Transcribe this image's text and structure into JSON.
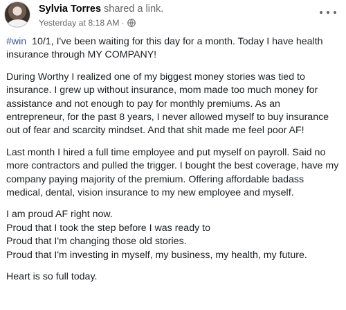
{
  "post": {
    "author": "Sylvia Torres",
    "action": "shared a link.",
    "timestamp": "Yesterday at 8:18 AM",
    "separator": "·",
    "privacy_icon": "globe-icon",
    "more_icon": "more-options-icon",
    "hashtag": "#win",
    "first_line": "10/1, I've been waiting for this day for a month. Today I have health insurance through MY COMPANY!",
    "paragraphs": [
      "During Worthy I realized one of my biggest money stories was tied to insurance. I grew up without insurance, mom made too much money for assistance and not enough to pay for monthly premiums.  As an entrepreneur, for the past 8 years, I never allowed myself to buy insurance out of fear and scarcity mindset. And that shit made me feel poor AF!",
      "Last month I hired a full time employee and put myself on payroll. Said no more contractors and pulled the trigger. I bought the best coverage, have my company paying majority of the premium. Offering affordable badass medical, dental, vision insurance to my new employee and myself."
    ],
    "proud_lines": [
      "I am proud AF right now.",
      "Proud that I took the step before I was ready to",
      "Proud that I'm changing those old stories.",
      "Proud that I'm investing in myself, my business, my health, my future."
    ],
    "closing": "Heart is so full today."
  },
  "colors": {
    "text": "#1c1e21",
    "secondary": "#65676b",
    "link": "#385898",
    "background": "#ffffff"
  }
}
